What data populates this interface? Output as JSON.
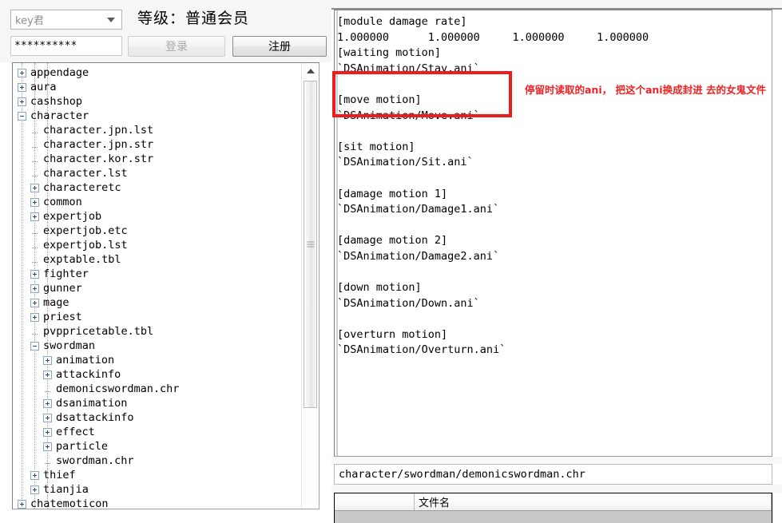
{
  "login": {
    "account_value": "key君",
    "account_placeholder": "key君",
    "dropdown_icon": "chevron-down-icon",
    "level_text": "等级：普通会员",
    "password_value": "**********",
    "login_label": "登录",
    "register_label": "注册",
    "login_enabled": false,
    "register_enabled": true
  },
  "tree": {
    "scrollbar": {
      "up_arrow_icon": "caret-up-icon",
      "grip_icon": "grip-lines-icon"
    },
    "nodes": [
      {
        "label": "appendage",
        "depth": 0,
        "type": "folder-collapsed"
      },
      {
        "label": "aura",
        "depth": 0,
        "type": "folder-collapsed"
      },
      {
        "label": "cashshop",
        "depth": 0,
        "type": "folder-collapsed"
      },
      {
        "label": "character",
        "depth": 0,
        "type": "folder-expanded"
      },
      {
        "label": "character.jpn.lst",
        "depth": 1,
        "type": "file"
      },
      {
        "label": "character.jpn.str",
        "depth": 1,
        "type": "file"
      },
      {
        "label": "character.kor.str",
        "depth": 1,
        "type": "file"
      },
      {
        "label": "character.lst",
        "depth": 1,
        "type": "file"
      },
      {
        "label": "characteretc",
        "depth": 1,
        "type": "folder-collapsed"
      },
      {
        "label": "common",
        "depth": 1,
        "type": "folder-collapsed"
      },
      {
        "label": "expertjob",
        "depth": 1,
        "type": "folder-collapsed"
      },
      {
        "label": "expertjob.etc",
        "depth": 1,
        "type": "file"
      },
      {
        "label": "expertjob.lst",
        "depth": 1,
        "type": "file"
      },
      {
        "label": "exptable.tbl",
        "depth": 1,
        "type": "file"
      },
      {
        "label": "fighter",
        "depth": 1,
        "type": "folder-collapsed"
      },
      {
        "label": "gunner",
        "depth": 1,
        "type": "folder-collapsed"
      },
      {
        "label": "mage",
        "depth": 1,
        "type": "folder-collapsed"
      },
      {
        "label": "priest",
        "depth": 1,
        "type": "folder-collapsed"
      },
      {
        "label": "pvppricetable.tbl",
        "depth": 1,
        "type": "file"
      },
      {
        "label": "swordman",
        "depth": 1,
        "type": "folder-expanded"
      },
      {
        "label": "animation",
        "depth": 2,
        "type": "folder-collapsed"
      },
      {
        "label": "attackinfo",
        "depth": 2,
        "type": "folder-collapsed"
      },
      {
        "label": "demonicswordman.chr",
        "depth": 2,
        "type": "file"
      },
      {
        "label": "dsanimation",
        "depth": 2,
        "type": "folder-collapsed"
      },
      {
        "label": "dsattackinfo",
        "depth": 2,
        "type": "folder-collapsed"
      },
      {
        "label": "effect",
        "depth": 2,
        "type": "folder-collapsed"
      },
      {
        "label": "particle",
        "depth": 2,
        "type": "folder-collapsed"
      },
      {
        "label": "swordman.chr",
        "depth": 2,
        "type": "file"
      },
      {
        "label": "thief",
        "depth": 1,
        "type": "folder-collapsed"
      },
      {
        "label": "tianjia",
        "depth": 1,
        "type": "folder-collapsed"
      },
      {
        "label": "chatemoticon",
        "depth": 0,
        "type": "folder-collapsed"
      }
    ]
  },
  "editor": {
    "content": "[module damage rate]\n1.000000      1.000000     1.000000     1.000000\n[waiting motion]\n`DSAnimation/Stay.ani`\n\n[move motion]\n`DSAnimation/Move.ani`\n\n[sit motion]\n`DSAnimation/Sit.ani`\n\n[damage motion 1]\n`DSAnimation/Damage1.ani`\n\n[damage motion 2]\n`DSAnimation/Damage2.ani`\n\n[down motion]\n`DSAnimation/Down.ani`\n\n[overturn motion]\n`DSAnimation/Overturn.ani`",
    "annotation_note": "停留时读取的ani，\n把这个ani换成封进\n去的女鬼文件",
    "highlight_color": "#ee1c1c",
    "annotation_color": "#ee2222"
  },
  "path_bar": {
    "value": "character/swordman/demonicswordman.chr"
  },
  "file_list": {
    "columns": [
      "",
      "文件名"
    ]
  }
}
